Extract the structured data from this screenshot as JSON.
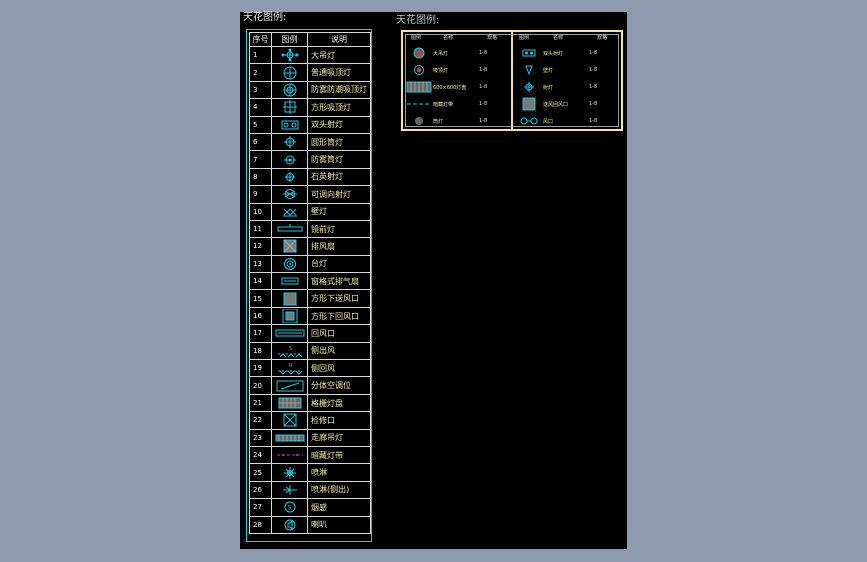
{
  "left_title": "天花图例:",
  "right_title": "天花图例:",
  "legend": {
    "headers": [
      "序号",
      "图例",
      "说明"
    ],
    "rows": [
      {
        "num": "1",
        "desc": "大吊灯",
        "icon": "chandelier-icon"
      },
      {
        "num": "2",
        "desc": "普通吸顶灯",
        "icon": "ceiling-light-icon"
      },
      {
        "num": "3",
        "desc": "防雾防潮吸顶灯",
        "icon": "moisture-ceiling-light-icon"
      },
      {
        "num": "4",
        "desc": "方形吸顶灯",
        "icon": "square-ceiling-light-icon"
      },
      {
        "num": "5",
        "desc": "双头射灯",
        "icon": "double-spotlight-icon"
      },
      {
        "num": "6",
        "desc": "圆形筒灯",
        "icon": "round-downlight-icon"
      },
      {
        "num": "7",
        "desc": "防雾筒灯",
        "icon": "anti-fog-downlight-icon"
      },
      {
        "num": "8",
        "desc": "石英射灯",
        "icon": "quartz-spotlight-icon"
      },
      {
        "num": "9",
        "desc": "可调向射灯",
        "icon": "adjustable-spotlight-icon"
      },
      {
        "num": "10",
        "desc": "壁灯",
        "icon": "wall-lamp-icon"
      },
      {
        "num": "11",
        "desc": "镜前灯",
        "icon": "mirror-light-icon"
      },
      {
        "num": "12",
        "desc": "排风扇",
        "icon": "exhaust-fan-icon"
      },
      {
        "num": "13",
        "desc": "台灯",
        "icon": "table-lamp-icon"
      },
      {
        "num": "14",
        "desc": "窗格式排气扇",
        "icon": "grille-exhaust-icon"
      },
      {
        "num": "15",
        "desc": "方形下送风口",
        "icon": "square-supply-vent-icon"
      },
      {
        "num": "16",
        "desc": "方形下回风口",
        "icon": "square-return-vent-icon"
      },
      {
        "num": "17",
        "desc": "回风口",
        "icon": "return-vent-icon"
      },
      {
        "num": "18",
        "desc": "侧出风",
        "icon": "side-supply-icon"
      },
      {
        "num": "19",
        "desc": "侧回风",
        "icon": "side-return-icon"
      },
      {
        "num": "20",
        "desc": "分体空调位",
        "icon": "split-ac-icon"
      },
      {
        "num": "21",
        "desc": "格栅灯盘",
        "icon": "grille-light-panel-icon"
      },
      {
        "num": "22",
        "desc": "检修口",
        "icon": "access-panel-icon"
      },
      {
        "num": "23",
        "desc": "走廊吊灯",
        "icon": "corridor-pendant-icon"
      },
      {
        "num": "24",
        "desc": "暗藏灯带",
        "icon": "hidden-light-strip-icon"
      },
      {
        "num": "25",
        "desc": "喷淋",
        "icon": "sprinkler-icon"
      },
      {
        "num": "26",
        "desc": "喷淋(侧出)",
        "icon": "side-sprinkler-icon"
      },
      {
        "num": "27",
        "desc": "烟感",
        "icon": "smoke-detector-icon"
      },
      {
        "num": "28",
        "desc": "喇叭",
        "icon": "speaker-icon"
      }
    ]
  },
  "right_legend": {
    "left_headers": [
      "图例",
      "名称",
      "规格"
    ],
    "right_headers": [
      "图例",
      "名称",
      "规格"
    ],
    "left_rows": [
      {
        "name": "大吊灯",
        "spec": "1-8"
      },
      {
        "name": "吸顶灯",
        "spec": "1-8"
      },
      {
        "name": "600×600灯盘",
        "spec": "1-8"
      },
      {
        "name": "暗藏灯带",
        "spec": "1-8"
      },
      {
        "name": "筒灯",
        "spec": "1-8"
      }
    ],
    "right_rows": [
      {
        "name": "双头射灯",
        "spec": "1-8"
      },
      {
        "name": "壁灯",
        "spec": "1-8"
      },
      {
        "name": "射灯",
        "spec": "1-8"
      },
      {
        "name": "送风回风口",
        "spec": "1-8"
      },
      {
        "name": "风口",
        "spec": "1-8"
      }
    ]
  },
  "colors": {
    "background": "#000000",
    "frame": "#1ec8e8",
    "cyan_symbol": "#1ec8e8",
    "text_yellow": "#f0e6a0",
    "magenta": "#d028d0",
    "window_bg": "#8c9bad"
  }
}
